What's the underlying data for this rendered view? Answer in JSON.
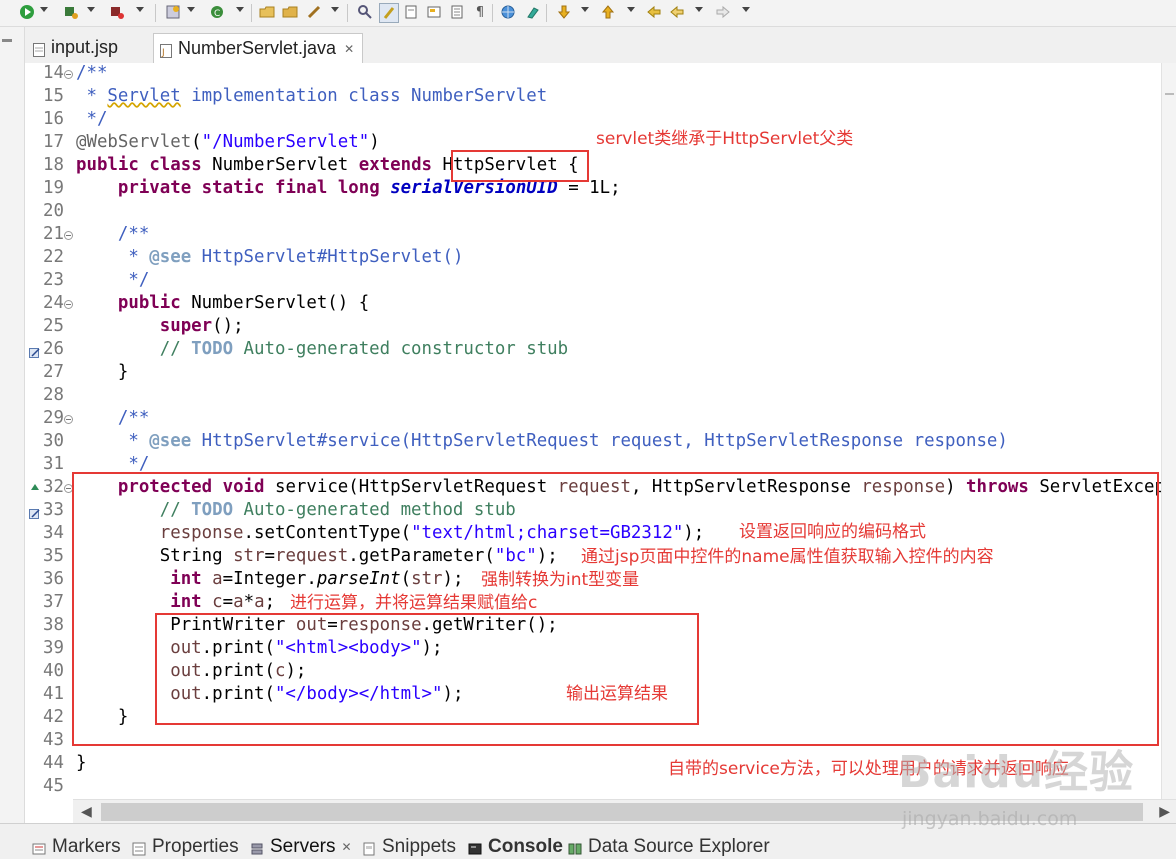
{
  "editor_tabs": [
    {
      "label": "input.jsp",
      "active": false
    },
    {
      "label": "NumberServlet.java",
      "active": true
    }
  ],
  "code_lines": [
    {
      "num": "14",
      "fold": true,
      "marker": "",
      "segments": [
        {
          "t": "/**",
          "c": "jd"
        }
      ]
    },
    {
      "num": "15",
      "fold": false,
      "marker": "",
      "segments": [
        {
          "t": " * ",
          "c": "jd"
        },
        {
          "t": "Servlet",
          "c": "jd ul"
        },
        {
          "t": " implementation class NumberServlet",
          "c": "jd"
        }
      ]
    },
    {
      "num": "16",
      "fold": false,
      "marker": "",
      "segments": [
        {
          "t": " */",
          "c": "jd"
        }
      ]
    },
    {
      "num": "17",
      "fold": false,
      "marker": "",
      "segments": [
        {
          "t": "@WebServlet",
          "c": "ann"
        },
        {
          "t": "(",
          "c": ""
        },
        {
          "t": "\"/NumberServlet\"",
          "c": "str"
        },
        {
          "t": ")",
          "c": ""
        }
      ]
    },
    {
      "num": "18",
      "fold": false,
      "marker": "",
      "segments": [
        {
          "t": "public",
          "c": "kw"
        },
        {
          "t": " ",
          "c": ""
        },
        {
          "t": "class",
          "c": "kw"
        },
        {
          "t": " NumberServlet ",
          "c": ""
        },
        {
          "t": "extends",
          "c": "kw"
        },
        {
          "t": " HttpServlet {",
          "c": ""
        }
      ]
    },
    {
      "num": "19",
      "fold": false,
      "marker": "",
      "segments": [
        {
          "t": "    ",
          "c": ""
        },
        {
          "t": "private",
          "c": "kw"
        },
        {
          "t": " ",
          "c": ""
        },
        {
          "t": "static",
          "c": "kw"
        },
        {
          "t": " ",
          "c": ""
        },
        {
          "t": "final",
          "c": "kw"
        },
        {
          "t": " ",
          "c": ""
        },
        {
          "t": "long",
          "c": "kw"
        },
        {
          "t": " ",
          "c": ""
        },
        {
          "t": "serialVersionUID",
          "c": "fld"
        },
        {
          "t": " = 1L;",
          "c": ""
        }
      ]
    },
    {
      "num": "20",
      "fold": false,
      "marker": "",
      "segments": []
    },
    {
      "num": "21",
      "fold": true,
      "marker": "",
      "segments": [
        {
          "t": "    /**",
          "c": "jd"
        }
      ]
    },
    {
      "num": "22",
      "fold": false,
      "marker": "",
      "segments": [
        {
          "t": "     * ",
          "c": "jd"
        },
        {
          "t": "@see",
          "c": "jd kwb"
        },
        {
          "t": " HttpServlet#HttpServlet()",
          "c": "jd"
        }
      ]
    },
    {
      "num": "23",
      "fold": false,
      "marker": "",
      "segments": [
        {
          "t": "     */",
          "c": "jd"
        }
      ]
    },
    {
      "num": "24",
      "fold": true,
      "marker": "",
      "segments": [
        {
          "t": "    ",
          "c": ""
        },
        {
          "t": "public",
          "c": "kw"
        },
        {
          "t": " NumberServlet() {",
          "c": ""
        }
      ]
    },
    {
      "num": "25",
      "fold": false,
      "marker": "",
      "segments": [
        {
          "t": "        ",
          "c": ""
        },
        {
          "t": "super",
          "c": "kw"
        },
        {
          "t": "();",
          "c": ""
        }
      ]
    },
    {
      "num": "26",
      "fold": false,
      "marker": "task",
      "segments": [
        {
          "t": "        // ",
          "c": "cm"
        },
        {
          "t": "TODO",
          "c": "todo"
        },
        {
          "t": " Auto-generated constructor stub",
          "c": "cm"
        }
      ]
    },
    {
      "num": "27",
      "fold": false,
      "marker": "",
      "segments": [
        {
          "t": "    }",
          "c": ""
        }
      ]
    },
    {
      "num": "28",
      "fold": false,
      "marker": "",
      "segments": []
    },
    {
      "num": "29",
      "fold": true,
      "marker": "",
      "segments": [
        {
          "t": "    /**",
          "c": "jd"
        }
      ]
    },
    {
      "num": "30",
      "fold": false,
      "marker": "",
      "segments": [
        {
          "t": "     * ",
          "c": "jd"
        },
        {
          "t": "@see",
          "c": "jd kwb"
        },
        {
          "t": " HttpServlet#service(HttpServletRequest request, HttpServletResponse response)",
          "c": "jd"
        }
      ]
    },
    {
      "num": "31",
      "fold": false,
      "marker": "",
      "segments": [
        {
          "t": "     */",
          "c": "jd"
        }
      ]
    },
    {
      "num": "32",
      "fold": true,
      "marker": "override",
      "segments": [
        {
          "t": "    ",
          "c": ""
        },
        {
          "t": "protected",
          "c": "kw"
        },
        {
          "t": " ",
          "c": ""
        },
        {
          "t": "void",
          "c": "kw"
        },
        {
          "t": " service(HttpServletRequest ",
          "c": ""
        },
        {
          "t": "request",
          "c": "var"
        },
        {
          "t": ", HttpServletResponse ",
          "c": ""
        },
        {
          "t": "response",
          "c": "var"
        },
        {
          "t": ") ",
          "c": ""
        },
        {
          "t": "throws",
          "c": "kw"
        },
        {
          "t": " ServletException, IOException {",
          "c": ""
        }
      ]
    },
    {
      "num": "33",
      "fold": false,
      "marker": "task",
      "segments": [
        {
          "t": "        // ",
          "c": "cm"
        },
        {
          "t": "TODO",
          "c": "todo"
        },
        {
          "t": " Auto-generated method stub",
          "c": "cm"
        }
      ]
    },
    {
      "num": "34",
      "fold": false,
      "marker": "",
      "segments": [
        {
          "t": "        ",
          "c": ""
        },
        {
          "t": "response",
          "c": "var"
        },
        {
          "t": ".setContentType(",
          "c": ""
        },
        {
          "t": "\"text/html;charset=GB2312\"",
          "c": "str"
        },
        {
          "t": ");",
          "c": ""
        }
      ]
    },
    {
      "num": "35",
      "fold": false,
      "marker": "",
      "segments": [
        {
          "t": "        String ",
          "c": ""
        },
        {
          "t": "str",
          "c": "var"
        },
        {
          "t": "=",
          "c": ""
        },
        {
          "t": "request",
          "c": "var"
        },
        {
          "t": ".getParameter(",
          "c": ""
        },
        {
          "t": "\"bc\"",
          "c": "str"
        },
        {
          "t": ");",
          "c": ""
        }
      ]
    },
    {
      "num": "36",
      "fold": false,
      "marker": "",
      "segments": [
        {
          "t": "         ",
          "c": ""
        },
        {
          "t": "int",
          "c": "kw"
        },
        {
          "t": " ",
          "c": ""
        },
        {
          "t": "a",
          "c": "var"
        },
        {
          "t": "=Integer.",
          "c": ""
        },
        {
          "t": "parseInt",
          "c": "it"
        },
        {
          "t": "(",
          "c": ""
        },
        {
          "t": "str",
          "c": "var"
        },
        {
          "t": ");",
          "c": ""
        }
      ]
    },
    {
      "num": "37",
      "fold": false,
      "marker": "",
      "segments": [
        {
          "t": "         ",
          "c": ""
        },
        {
          "t": "int",
          "c": "kw"
        },
        {
          "t": " ",
          "c": ""
        },
        {
          "t": "c",
          "c": "var"
        },
        {
          "t": "=",
          "c": ""
        },
        {
          "t": "a",
          "c": "var"
        },
        {
          "t": "*",
          "c": ""
        },
        {
          "t": "a",
          "c": "var"
        },
        {
          "t": ";",
          "c": ""
        }
      ]
    },
    {
      "num": "38",
      "fold": false,
      "marker": "",
      "segments": [
        {
          "t": "         PrintWriter ",
          "c": ""
        },
        {
          "t": "out",
          "c": "var"
        },
        {
          "t": "=",
          "c": ""
        },
        {
          "t": "response",
          "c": "var"
        },
        {
          "t": ".getWriter();",
          "c": ""
        }
      ]
    },
    {
      "num": "39",
      "fold": false,
      "marker": "",
      "segments": [
        {
          "t": "         ",
          "c": ""
        },
        {
          "t": "out",
          "c": "var"
        },
        {
          "t": ".print(",
          "c": ""
        },
        {
          "t": "\"<html><body>\"",
          "c": "str"
        },
        {
          "t": ");",
          "c": ""
        }
      ]
    },
    {
      "num": "40",
      "fold": false,
      "marker": "",
      "segments": [
        {
          "t": "         ",
          "c": ""
        },
        {
          "t": "out",
          "c": "var"
        },
        {
          "t": ".print(",
          "c": ""
        },
        {
          "t": "c",
          "c": "var"
        },
        {
          "t": ");",
          "c": ""
        }
      ]
    },
    {
      "num": "41",
      "fold": false,
      "marker": "",
      "segments": [
        {
          "t": "         ",
          "c": ""
        },
        {
          "t": "out",
          "c": "var"
        },
        {
          "t": ".print(",
          "c": ""
        },
        {
          "t": "\"</body></html>\"",
          "c": "str"
        },
        {
          "t": ");",
          "c": ""
        }
      ]
    },
    {
      "num": "42",
      "fold": false,
      "marker": "",
      "segments": [
        {
          "t": "    }",
          "c": ""
        }
      ]
    },
    {
      "num": "43",
      "fold": false,
      "marker": "",
      "segments": []
    },
    {
      "num": "44",
      "fold": false,
      "marker": "",
      "segments": [
        {
          "t": "}",
          "c": ""
        }
      ]
    },
    {
      "num": "45",
      "fold": false,
      "marker": "",
      "segments": []
    }
  ],
  "annotations": {
    "inherit_note": "servlet类继承于HttpServlet父类",
    "encoding_note": "设置返回响应的编码格式",
    "param_note": "通过jsp页面中控件的name属性值获取输入控件的内容",
    "cast_note": "强制转换为int型变量",
    "compute_note": "进行运算，并将运算结果赋值给c",
    "output_note": "输出运算结果",
    "service_note": "自带的service方法，可以处理用户的请求并返回响应"
  },
  "bottom_tabs": [
    {
      "label": "Markers",
      "icon": "markers-icon",
      "active": false
    },
    {
      "label": "Properties",
      "icon": "properties-icon",
      "active": false
    },
    {
      "label": "Servers",
      "icon": "servers-icon",
      "active": true
    },
    {
      "label": "Snippets",
      "icon": "snippets-icon",
      "active": false
    },
    {
      "label": "Console",
      "icon": "console-icon",
      "active": false
    },
    {
      "label": "Data Source Explorer",
      "icon": "data-source-icon",
      "active": false
    }
  ],
  "watermark": {
    "logo": "Baidu经验",
    "url": "jingyan.baidu.com"
  },
  "colors": {
    "annotation": "#e53935",
    "keyword": "#7f0055",
    "javadoc": "#3f5fbf",
    "comment": "#3f7f5f",
    "string": "#2a00ff"
  }
}
